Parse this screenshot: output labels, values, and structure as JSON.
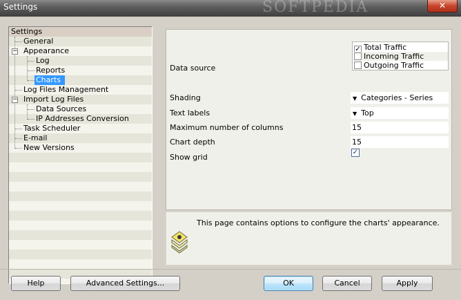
{
  "window": {
    "title": "Settings",
    "watermark": "SOFTPEDIA",
    "close_glyph": "✕"
  },
  "tree": {
    "root": "Settings",
    "items": [
      {
        "label": "General"
      },
      {
        "label": "Appearance",
        "expander": "−"
      },
      {
        "label": "Log"
      },
      {
        "label": "Reports"
      },
      {
        "label": "Charts"
      },
      {
        "label": "Log Files Management"
      },
      {
        "label": "Import Log Files",
        "expander": "−"
      },
      {
        "label": "Data Sources"
      },
      {
        "label": "IP Addresses Conversion"
      },
      {
        "label": "Task Scheduler"
      },
      {
        "label": "E-mail"
      },
      {
        "label": "New Versions"
      }
    ]
  },
  "form": {
    "data_source_label": "Data source",
    "data_source_options": [
      {
        "label": "Total Traffic",
        "checked": true
      },
      {
        "label": "Incoming Traffic",
        "checked": false
      },
      {
        "label": "Outgoing Traffic",
        "checked": false
      }
    ],
    "shading_label": "Shading",
    "shading_value": "Categories - Series",
    "text_labels_label": "Text labels",
    "text_labels_value": "Top",
    "max_columns_label": "Maximum number of columns",
    "max_columns_value": "15",
    "chart_depth_label": "Chart depth",
    "chart_depth_value": "15",
    "show_grid_label": "Show grid",
    "show_grid_checked": true,
    "dropdown_icon": "▼",
    "check_glyph": "✓"
  },
  "info": {
    "text": "This page contains options to configure the charts' appearance."
  },
  "buttons": {
    "help": "Help",
    "advanced": "Advanced Settings...",
    "ok": "OK",
    "cancel": "Cancel",
    "apply": "Apply"
  },
  "colors": {
    "selection": "#3399ff",
    "tree_stripe_a": "#f4f3ec",
    "tree_stripe_b": "#e6e5da"
  }
}
